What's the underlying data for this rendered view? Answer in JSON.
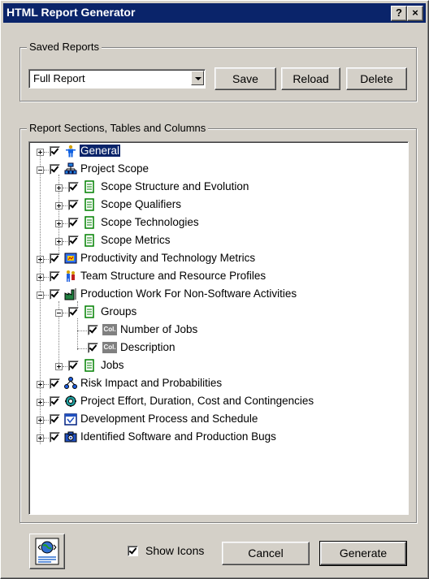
{
  "window": {
    "title": "HTML Report Generator",
    "help_glyph": "?",
    "close_glyph": "×"
  },
  "saved_reports": {
    "legend": "Saved Reports",
    "selected": "Full Report",
    "save_label": "Save",
    "reload_label": "Reload",
    "delete_label": "Delete"
  },
  "sections": {
    "legend": "Report Sections, Tables and Columns",
    "items": [
      {
        "label": "General",
        "icon": "person-icon",
        "expander": "plus",
        "checked": true,
        "selected": true
      },
      {
        "label": "Project Scope",
        "icon": "org-chart-icon",
        "expander": "minus",
        "checked": true
      },
      {
        "label": "Scope Structure and Evolution",
        "icon": "table-icon",
        "expander": "plus",
        "checked": true
      },
      {
        "label": "Scope Qualifiers",
        "icon": "table-icon",
        "expander": "plus",
        "checked": true
      },
      {
        "label": "Scope Technologies",
        "icon": "table-icon",
        "expander": "plus",
        "checked": true
      },
      {
        "label": "Scope Metrics",
        "icon": "table-icon",
        "expander": "plus",
        "checked": true
      },
      {
        "label": "Productivity and Technology Metrics",
        "icon": "metrics-icon",
        "expander": "plus",
        "checked": true
      },
      {
        "label": "Team Structure and Resource Profiles",
        "icon": "team-icon",
        "expander": "plus",
        "checked": true
      },
      {
        "label": "Production Work For Non-Software Activities",
        "icon": "production-icon",
        "expander": "minus",
        "checked": true
      },
      {
        "label": "Groups",
        "icon": "table-icon",
        "expander": "minus",
        "checked": true
      },
      {
        "label": "Number of Jobs",
        "icon": "column-icon",
        "icon_text": "Col.",
        "checked": true
      },
      {
        "label": "Description",
        "icon": "column-icon",
        "icon_text": "Col.",
        "checked": true
      },
      {
        "label": "Jobs",
        "icon": "table-icon",
        "expander": "plus",
        "checked": true
      },
      {
        "label": "Risk Impact and Probabilities",
        "icon": "risk-icon",
        "expander": "plus",
        "checked": true
      },
      {
        "label": "Project Effort, Duration, Cost and Contingencies",
        "icon": "effort-icon",
        "expander": "plus",
        "checked": true
      },
      {
        "label": "Development Process and Schedule",
        "icon": "schedule-icon",
        "expander": "plus",
        "checked": true
      },
      {
        "label": "Identified Software and Production Bugs",
        "icon": "camera-icon",
        "expander": "plus",
        "checked": true
      }
    ]
  },
  "footer": {
    "show_icons_label": "Show Icons",
    "show_icons_checked": true,
    "cancel_label": "Cancel",
    "generate_label": "Generate",
    "big_icon": "web-report-icon"
  }
}
